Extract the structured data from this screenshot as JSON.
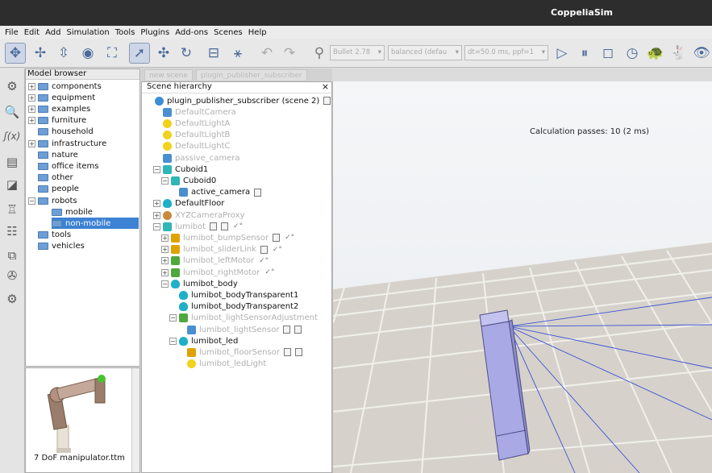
{
  "window": {
    "title": "CoppeliaSim"
  },
  "menu": [
    "File",
    "Edit",
    "Add",
    "Simulation",
    "Tools",
    "Plugins",
    "Add-ons",
    "Scenes",
    "Help"
  ],
  "toolbar": {
    "engine": "Bullet 2.78",
    "accuracy": "balanced (defau",
    "dt": "dt=50.0 ms, ppf=1"
  },
  "model_browser": {
    "title": "Model browser",
    "items": [
      {
        "label": "components",
        "expander": "+",
        "depth": 0
      },
      {
        "label": "equipment",
        "expander": "+",
        "depth": 0
      },
      {
        "label": "examples",
        "expander": "+",
        "depth": 0
      },
      {
        "label": "furniture",
        "expander": "+",
        "depth": 0
      },
      {
        "label": "household",
        "expander": "",
        "depth": 0
      },
      {
        "label": "infrastructure",
        "expander": "+",
        "depth": 0
      },
      {
        "label": "nature",
        "expander": "",
        "depth": 0
      },
      {
        "label": "office items",
        "expander": "",
        "depth": 0
      },
      {
        "label": "other",
        "expander": "",
        "depth": 0
      },
      {
        "label": "people",
        "expander": "",
        "depth": 0
      },
      {
        "label": "robots",
        "expander": "−",
        "depth": 0
      },
      {
        "label": "mobile",
        "expander": "",
        "depth": 1
      },
      {
        "label": "non-mobile",
        "expander": "",
        "depth": 1,
        "selected": true
      },
      {
        "label": "tools",
        "expander": "",
        "depth": 0
      },
      {
        "label": "vehicles",
        "expander": "",
        "depth": 0
      }
    ]
  },
  "preview": {
    "caption": "7 DoF manipulator.ttm"
  },
  "scene_tabs": [
    "new scene",
    "plugin_publisher_subscriber"
  ],
  "hierarchy": {
    "title": "Scene hierarchy",
    "close": "×",
    "items": [
      {
        "label": "plugin_publisher_subscriber (scene 2)",
        "icon": "world",
        "indent": 0,
        "dim": false,
        "script": 1
      },
      {
        "label": "DefaultCamera",
        "icon": "cam",
        "indent": 1,
        "dim": true
      },
      {
        "label": "DefaultLightA",
        "icon": "light",
        "indent": 1,
        "dim": true
      },
      {
        "label": "DefaultLightB",
        "icon": "light",
        "indent": 1,
        "dim": true
      },
      {
        "label": "DefaultLightC",
        "icon": "light",
        "indent": 1,
        "dim": true
      },
      {
        "label": "passive_camera",
        "icon": "cam",
        "indent": 1,
        "dim": true
      },
      {
        "label": "Cuboid1",
        "icon": "box",
        "indent": 1,
        "dim": false,
        "exp": "−"
      },
      {
        "label": "Cuboid0",
        "icon": "box",
        "indent": 2,
        "dim": false,
        "exp": "−"
      },
      {
        "label": "active_camera",
        "icon": "cam",
        "indent": 3,
        "dim": false,
        "script": 1
      },
      {
        "label": "DefaultFloor",
        "icon": "drop",
        "indent": 1,
        "dim": false,
        "exp": "+"
      },
      {
        "label": "XYZCameraProxy",
        "icon": "proxy",
        "indent": 1,
        "dim": true,
        "exp": "+"
      },
      {
        "label": "lumibot",
        "icon": "box",
        "indent": 1,
        "dim": true,
        "exp": "−",
        "script": 2,
        "check": 1
      },
      {
        "label": "lumibot_bumpSensor",
        "icon": "sensor",
        "indent": 2,
        "dim": true,
        "exp": "+",
        "script": 1,
        "check": 1
      },
      {
        "label": "lumibot_sliderLink",
        "icon": "sensor",
        "indent": 2,
        "dim": true,
        "exp": "+",
        "script": 1,
        "check": 1
      },
      {
        "label": "lumibot_leftMotor",
        "icon": "motor",
        "indent": 2,
        "dim": true,
        "exp": "+",
        "check": 1
      },
      {
        "label": "lumibot_rightMotor",
        "icon": "motor",
        "indent": 2,
        "dim": true,
        "exp": "+",
        "check": 1
      },
      {
        "label": "lumibot_body",
        "icon": "drop",
        "indent": 2,
        "dim": false,
        "exp": "−"
      },
      {
        "label": "lumibot_bodyTransparent1",
        "icon": "drop",
        "indent": 3,
        "dim": false
      },
      {
        "label": "lumibot_bodyTransparent2",
        "icon": "drop",
        "indent": 3,
        "dim": false
      },
      {
        "label": "lumibot_lightSensorAdjustment",
        "icon": "motor",
        "indent": 3,
        "dim": true,
        "exp": "−"
      },
      {
        "label": "lumibot_lightSensor",
        "icon": "cam",
        "indent": 4,
        "dim": true,
        "script": 2
      },
      {
        "label": "lumibot_led",
        "icon": "drop",
        "indent": 3,
        "dim": false,
        "exp": "−"
      },
      {
        "label": "lumibot_floorSensor",
        "icon": "sensor",
        "indent": 4,
        "dim": true,
        "script": 2
      },
      {
        "label": "lumibot_ledLight",
        "icon": "light",
        "indent": 4,
        "dim": true
      }
    ]
  },
  "viewport": {
    "calc_text": "Calculation passes: 10 (2 ms)"
  }
}
